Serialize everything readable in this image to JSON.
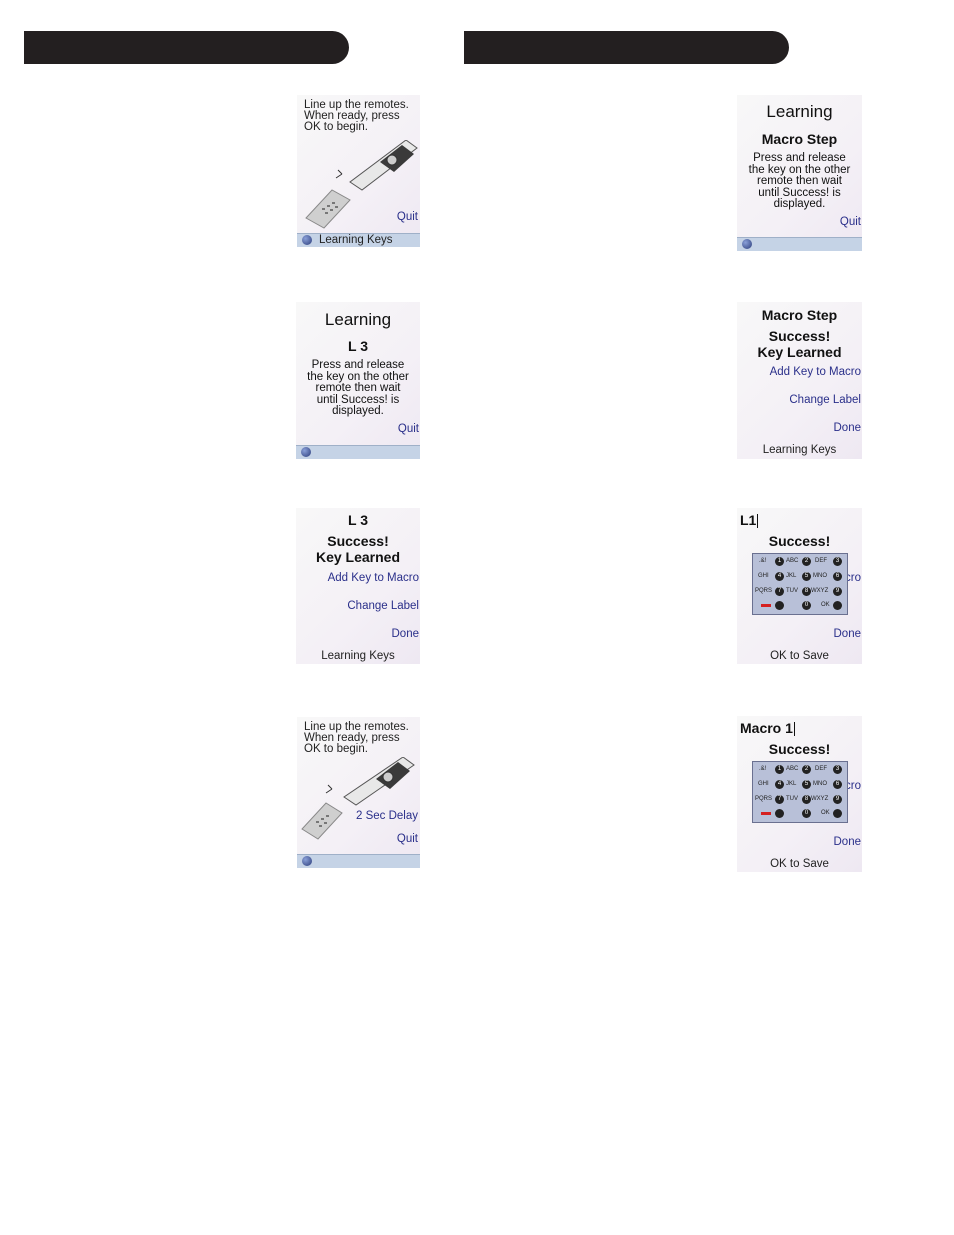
{
  "colors": {
    "banner": "#231f20",
    "link": "#2a2f8a",
    "statusbar": "#c5d3e6"
  },
  "left": [
    {
      "lines": [
        "Line up the remotes.",
        "When ready, press",
        "OK to begin."
      ],
      "quit": "Quit",
      "status": "Learning Keys"
    },
    {
      "title": "Learning",
      "sub": "L 3",
      "lines": [
        "Press and release",
        "the key on the other",
        "remote then wait",
        "until Success! is",
        "displayed."
      ],
      "quit": "Quit"
    },
    {
      "sub": "L 3",
      "success": "Success!",
      "learned": "Key Learned",
      "add": "Add Key to Macro",
      "change": "Change Label",
      "done": "Done",
      "footer": "Learning Keys"
    },
    {
      "lines": [
        "Line up the remotes.",
        "When ready, press",
        "OK to begin."
      ],
      "delay": "2 Sec Delay",
      "quit": "Quit"
    }
  ],
  "right": [
    {
      "title": "Learning",
      "sub": "Macro Step",
      "lines": [
        "Press and release",
        "the key on the other",
        "remote then wait",
        "until Success! is",
        "displayed."
      ],
      "quit": "Quit"
    },
    {
      "sub": "Macro Step",
      "success": "Success!",
      "learned": "Key Learned",
      "add": "Add Key to Macro",
      "change": "Change Label",
      "done": "Done",
      "footer": "Learning Keys"
    },
    {
      "entry": "L1",
      "success": "Success!",
      "partial": "cro",
      "done": "Done",
      "footer": "OK to Save"
    },
    {
      "entry": "Macro 1",
      "success": "Success!",
      "partial": "cro",
      "done": "Done",
      "footer": "OK to Save"
    }
  ],
  "keypad": {
    "rows": [
      [
        ".&!",
        "1",
        "ABC",
        "2",
        "DEF",
        "3"
      ],
      [
        "GHI",
        "4",
        "JKL",
        "5",
        "MNO",
        "6"
      ],
      [
        "PQRS",
        "7",
        "TUV",
        "8",
        "WXYZ",
        "9"
      ],
      [
        "",
        "",
        "",
        "0",
        "OK",
        ""
      ]
    ]
  }
}
